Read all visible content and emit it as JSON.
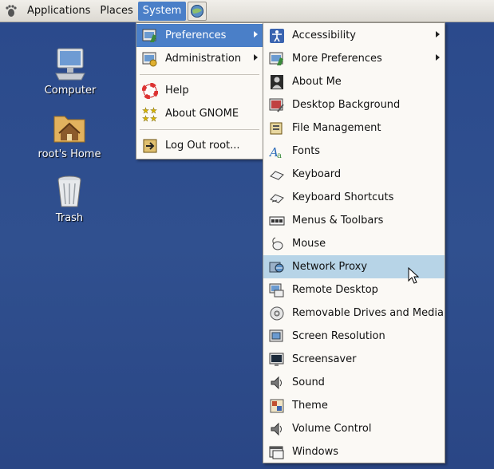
{
  "panel": {
    "menus": [
      {
        "label": "Applications"
      },
      {
        "label": "Places"
      },
      {
        "label": "System"
      }
    ]
  },
  "desktop": {
    "icons": [
      {
        "label": "Computer"
      },
      {
        "label": "root's Home"
      },
      {
        "label": "Trash"
      }
    ]
  },
  "system_menu": {
    "items": [
      {
        "label": "Preferences",
        "submenu": true
      },
      {
        "label": "Administration",
        "submenu": true
      },
      {
        "label": "Help"
      },
      {
        "label": "About GNOME"
      },
      {
        "label": "Log Out root..."
      }
    ]
  },
  "preferences_menu": {
    "items": [
      {
        "label": "Accessibility",
        "submenu": true,
        "icon": "accessibility-icon"
      },
      {
        "label": "More Preferences",
        "submenu": true,
        "icon": "more-preferences-icon"
      },
      {
        "label": "About Me",
        "icon": "about-me-icon"
      },
      {
        "label": "Desktop Background",
        "icon": "desktop-background-icon"
      },
      {
        "label": "File Management",
        "icon": "file-management-icon"
      },
      {
        "label": "Fonts",
        "icon": "fonts-icon"
      },
      {
        "label": "Keyboard",
        "icon": "keyboard-icon"
      },
      {
        "label": "Keyboard Shortcuts",
        "icon": "keyboard-shortcuts-icon"
      },
      {
        "label": "Menus & Toolbars",
        "icon": "menus-toolbars-icon"
      },
      {
        "label": "Mouse",
        "icon": "mouse-icon"
      },
      {
        "label": "Network Proxy",
        "icon": "network-proxy-icon",
        "hovered": true
      },
      {
        "label": "Remote Desktop",
        "icon": "remote-desktop-icon"
      },
      {
        "label": "Removable Drives and Media",
        "icon": "removable-drives-icon"
      },
      {
        "label": "Screen Resolution",
        "icon": "screen-resolution-icon"
      },
      {
        "label": "Screensaver",
        "icon": "screensaver-icon"
      },
      {
        "label": "Sound",
        "icon": "sound-icon"
      },
      {
        "label": "Theme",
        "icon": "theme-icon"
      },
      {
        "label": "Volume Control",
        "icon": "volume-control-icon"
      },
      {
        "label": "Windows",
        "icon": "windows-icon"
      }
    ]
  },
  "colors": {
    "selection": "#4a7fc8",
    "hover": "#b7d4e7",
    "menu_bg": "#fbf9f5",
    "desktop_bg": "#2f4c8c"
  }
}
